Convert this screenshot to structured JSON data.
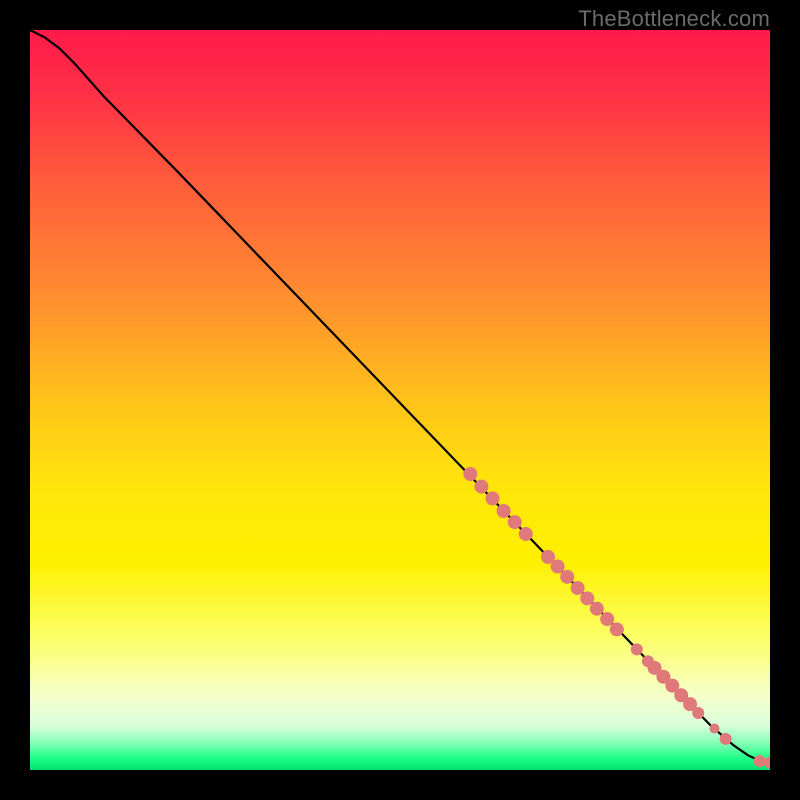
{
  "watermark": "TheBottleneck.com",
  "chart_data": {
    "type": "line",
    "title": "",
    "xlabel": "",
    "ylabel": "",
    "xlim": [
      0,
      100
    ],
    "ylim": [
      0,
      100
    ],
    "grid": false,
    "background_gradient": {
      "stops": [
        {
          "pos": 0.0,
          "color": "#ff1a4b"
        },
        {
          "pos": 0.08,
          "color": "#ff2e46"
        },
        {
          "pos": 0.2,
          "color": "#ff5a3c"
        },
        {
          "pos": 0.35,
          "color": "#ff8a30"
        },
        {
          "pos": 0.5,
          "color": "#ffc21a"
        },
        {
          "pos": 0.62,
          "color": "#ffe60a"
        },
        {
          "pos": 0.72,
          "color": "#fff000"
        },
        {
          "pos": 0.82,
          "color": "#fcff66"
        },
        {
          "pos": 0.9,
          "color": "#f6ffcc"
        },
        {
          "pos": 0.94,
          "color": "#d9ffd9"
        },
        {
          "pos": 0.965,
          "color": "#7dffb3"
        },
        {
          "pos": 0.985,
          "color": "#1aff86"
        },
        {
          "pos": 1.0,
          "color": "#00e070"
        }
      ]
    },
    "series": [
      {
        "name": "curve",
        "stroke": "#000000",
        "x": [
          0,
          2,
          4,
          6,
          10,
          20,
          30,
          40,
          50,
          60,
          70,
          80,
          88,
          92,
          95,
          97,
          98.5,
          99.5,
          100
        ],
        "y": [
          100,
          99,
          97.5,
          95.5,
          91,
          80.8,
          70.4,
          60,
          49.6,
          39.2,
          28.8,
          18.4,
          10.1,
          6.0,
          3.4,
          2.0,
          1.3,
          1.0,
          1.0
        ]
      }
    ],
    "scatter": [
      {
        "name": "clusters",
        "color": "#e07a7a",
        "points": [
          {
            "x": 59.5,
            "y": 40.0,
            "r": 7
          },
          {
            "x": 61.0,
            "y": 38.3,
            "r": 7
          },
          {
            "x": 62.5,
            "y": 36.7,
            "r": 7
          },
          {
            "x": 64.0,
            "y": 35.0,
            "r": 7
          },
          {
            "x": 65.5,
            "y": 33.5,
            "r": 7
          },
          {
            "x": 67.0,
            "y": 31.9,
            "r": 7
          },
          {
            "x": 70.0,
            "y": 28.8,
            "r": 7
          },
          {
            "x": 71.3,
            "y": 27.5,
            "r": 7
          },
          {
            "x": 72.6,
            "y": 26.1,
            "r": 7
          },
          {
            "x": 74.0,
            "y": 24.6,
            "r": 7
          },
          {
            "x": 75.3,
            "y": 23.2,
            "r": 7
          },
          {
            "x": 76.6,
            "y": 21.8,
            "r": 7
          },
          {
            "x": 78.0,
            "y": 20.4,
            "r": 7
          },
          {
            "x": 79.3,
            "y": 19.0,
            "r": 7
          },
          {
            "x": 82.0,
            "y": 16.3,
            "r": 6
          },
          {
            "x": 83.5,
            "y": 14.7,
            "r": 6
          },
          {
            "x": 84.4,
            "y": 13.8,
            "r": 7
          },
          {
            "x": 85.6,
            "y": 12.6,
            "r": 7
          },
          {
            "x": 86.8,
            "y": 11.4,
            "r": 7
          },
          {
            "x": 88.0,
            "y": 10.1,
            "r": 7
          },
          {
            "x": 89.2,
            "y": 8.9,
            "r": 7
          },
          {
            "x": 90.3,
            "y": 7.7,
            "r": 6
          },
          {
            "x": 92.5,
            "y": 5.6,
            "r": 5
          },
          {
            "x": 94.0,
            "y": 4.2,
            "r": 6
          },
          {
            "x": 98.6,
            "y": 1.2,
            "r": 6
          },
          {
            "x": 100.0,
            "y": 1.0,
            "r": 6
          }
        ]
      }
    ]
  }
}
